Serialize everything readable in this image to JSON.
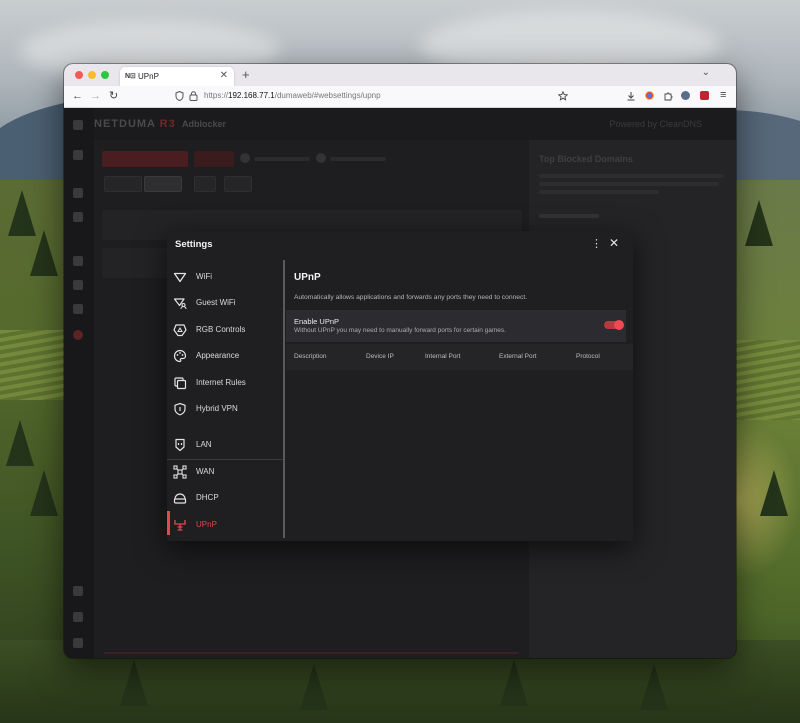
{
  "browser": {
    "tab_favicon": "N⊡",
    "tab_title": "UPnP",
    "tab_close": "✕",
    "new_tab": "+",
    "tab_menu": "⌄",
    "url_prefix": "https://",
    "url_host": "192.168.77.1",
    "url_path": "/dumaweb/#websettings/upnp",
    "nav_back": "←",
    "nav_forward": "→",
    "nav_reload": "↻",
    "menu_icon": "≡"
  },
  "app": {
    "logo_main": "NETDUMA",
    "logo_accent": "R3",
    "header_title": "Adblocker",
    "header_right": "Powered by CleanDNS",
    "right_panel_title": "Top Blocked Domains"
  },
  "dialog": {
    "title": "Settings",
    "more_icon": "⋮",
    "close_icon": "✕",
    "menu": [
      {
        "label": "WiFi",
        "icon": "wifi-icon"
      },
      {
        "label": "Guest WiFi",
        "icon": "guest-wifi-icon"
      },
      {
        "label": "RGB Controls",
        "icon": "rgb-controls-icon"
      },
      {
        "label": "Appearance",
        "icon": "palette-icon"
      },
      {
        "label": "Internet Rules",
        "icon": "internet-rules-icon"
      },
      {
        "label": "Hybrid VPN",
        "icon": "shield-icon"
      },
      {
        "label": "LAN",
        "icon": "lan-icon"
      },
      {
        "label": "WAN",
        "icon": "wan-icon"
      },
      {
        "label": "DHCP",
        "icon": "dhcp-icon"
      },
      {
        "label": "UPnP",
        "icon": "upnp-icon",
        "active": true
      }
    ],
    "content": {
      "title": "UPnP",
      "description": "Automatically allows applications and forwards any ports they need to connect.",
      "enable_title": "Enable UPnP",
      "enable_sub": "Without UPnP you may need to manually forward ports for certain games.",
      "enabled": true,
      "columns": [
        "Description",
        "Device IP",
        "Internal Port",
        "External Port",
        "Protocol"
      ]
    }
  },
  "colors": {
    "accent": "#e8454f",
    "dialog_bg": "#1f1e21",
    "row_bg": "#2c2b2f"
  }
}
